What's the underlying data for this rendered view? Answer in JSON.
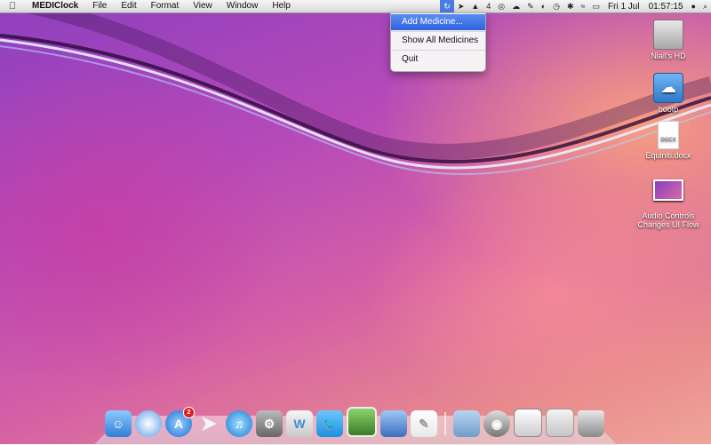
{
  "menubar": {
    "app_name": "MEDIClock",
    "menus": [
      "File",
      "Edit",
      "Format",
      "View",
      "Window",
      "Help"
    ],
    "status_icons": [
      "mediclock-icon",
      "cursor-icon",
      "adobe-icon",
      "wifi-extra-icon",
      "cloud-icon",
      "pen-icon",
      "sync-icon",
      "timemachine-icon",
      "bluetooth-icon",
      "wifi-icon",
      "battery-icon"
    ],
    "status_text": "4",
    "date": "Fri 1 Jul",
    "time": "01:57:15"
  },
  "dropdown": {
    "items": [
      "Add Medicine...",
      "Show All Medicines",
      "Quit"
    ],
    "highlighted": 0
  },
  "desktop": {
    "icons": [
      {
        "label": "Niall's HD",
        "type": "hard-drive-icon"
      },
      {
        "label": "bootp",
        "type": "cloud-drive-icon"
      },
      {
        "label": "Equiniti.docx",
        "type": "document-icon",
        "doc_tag": "DOCX"
      },
      {
        "label": "Audio Controls\nChanges UI Flow",
        "type": "image-file-icon"
      }
    ]
  },
  "dock": {
    "badge_count": "2",
    "apps": [
      "finder-icon",
      "safari-icon",
      "app-store-icon",
      "sparrow-icon",
      "itunes-icon",
      "system-preferences-icon",
      "wunderlist-icon",
      "twitter-icon",
      "iphoto-icon",
      "preview-icon",
      "textedit-icon"
    ],
    "right_items": [
      "folder-icon",
      "screenshot-app-icon",
      "screenshots-stack-icon",
      "downloads-stack-icon",
      "trash-icon"
    ]
  },
  "colors": {
    "menu_highlight": "#3b6fe6",
    "badge": "#e02020"
  }
}
